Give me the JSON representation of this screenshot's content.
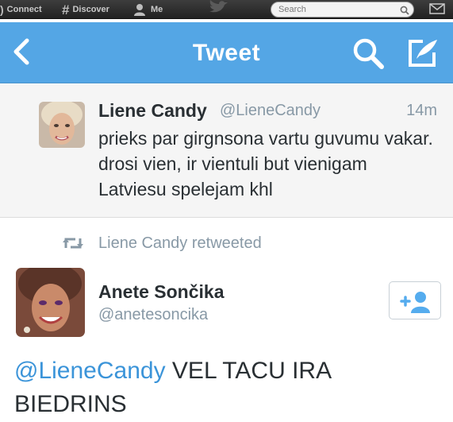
{
  "topbar": {
    "connect_label": "Connect",
    "discover_label": "Discover",
    "me_label": "Me",
    "search_placeholder": "Search",
    "icons": [
      "connect-icon",
      "hash-icon",
      "person-icon",
      "bird-icon",
      "search-icon",
      "mail-icon"
    ]
  },
  "navbar": {
    "title": "Tweet",
    "icons": [
      "back-arrow-icon",
      "search-icon",
      "compose-icon"
    ],
    "background_color": "#54a6e5"
  },
  "tweet": {
    "name": "Liene Candy",
    "handle": "@LieneCandy",
    "time": "14m",
    "text": "prieks par girgnsona vartu guvumu vakar. drosi vien, ir vientuli but vienigam Latviesu spelejam khl"
  },
  "retweet_context": {
    "label": "Liene Candy retweeted",
    "icon": "retweet-icon"
  },
  "retweeted_tweet": {
    "name": "Anete Sončika",
    "handle": "@anetesoncika",
    "mention": "@LieneCandy",
    "text": "VEL TACU IRA BIEDRINS",
    "follow_icon": "add-user-icon"
  },
  "colors": {
    "link": "#3b94d9",
    "muted": "#8899a6",
    "text": "#292f33"
  }
}
